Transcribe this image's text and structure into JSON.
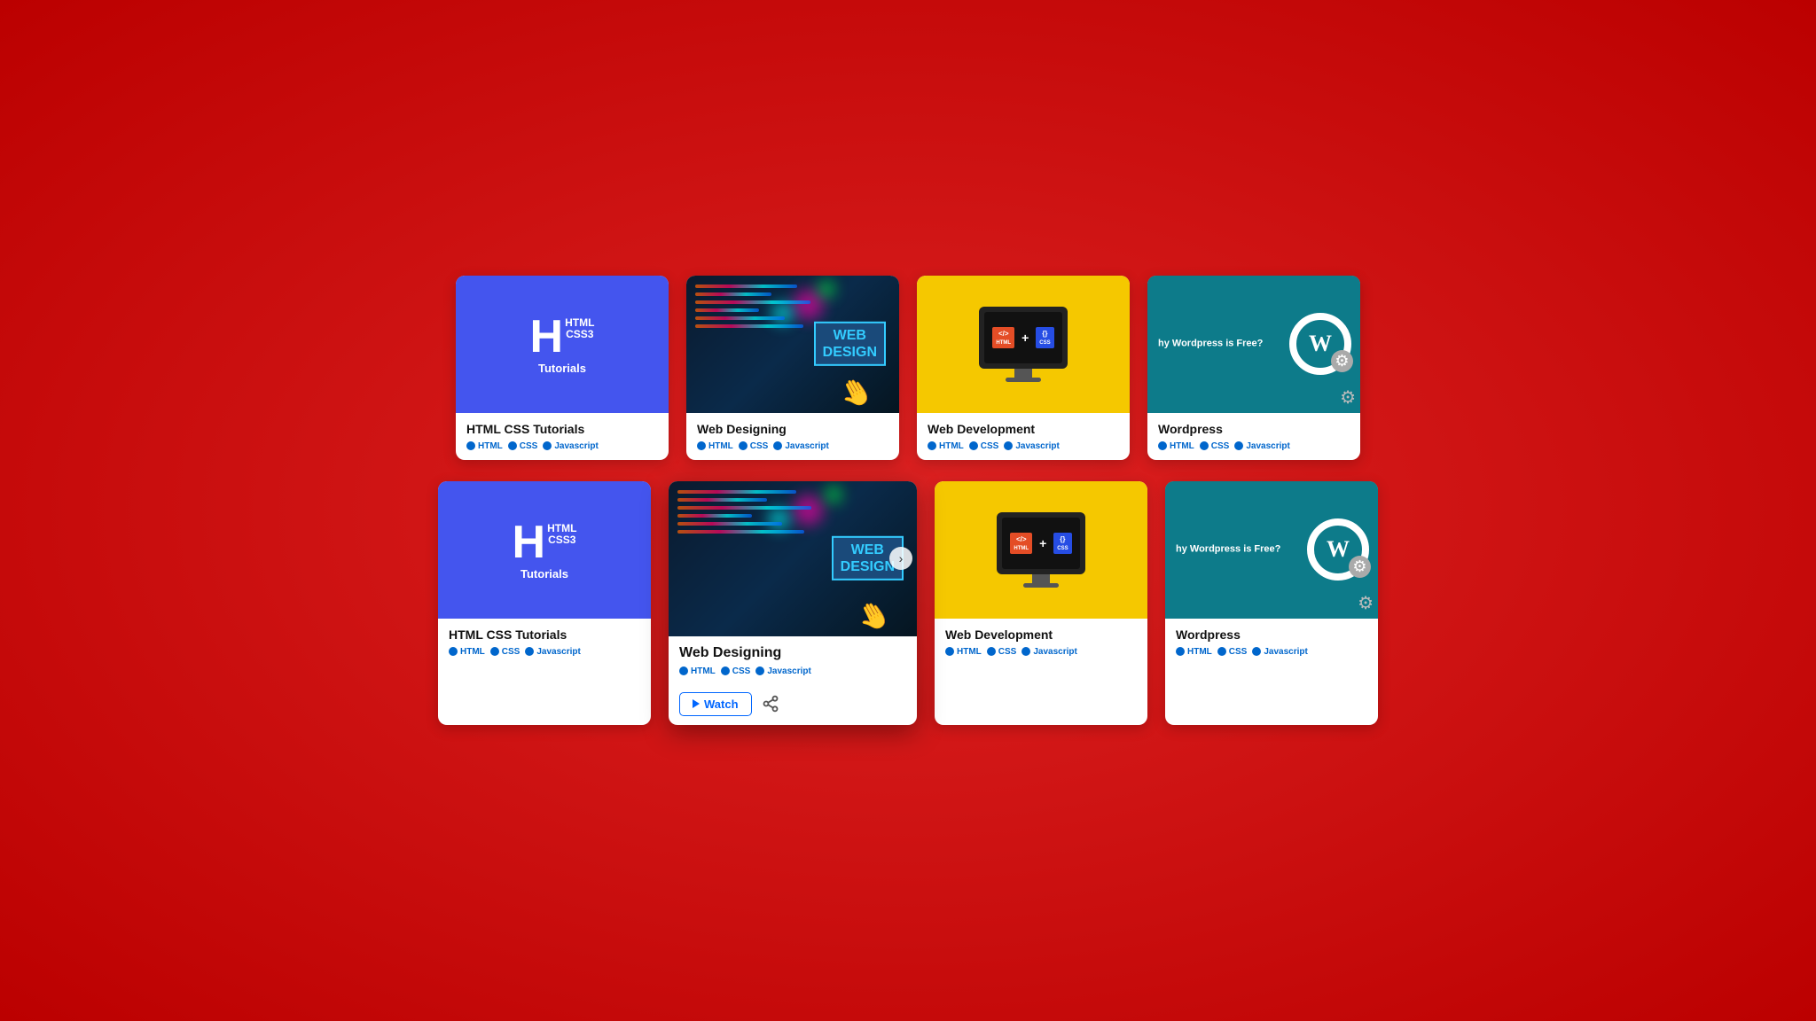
{
  "rows": [
    {
      "id": "row1",
      "cards": [
        {
          "id": "card-html-css-1",
          "type": "html-css",
          "title": "HTML CSS Tutorials",
          "tags": [
            "HTML",
            "CSS",
            "Javascript"
          ],
          "expanded": false,
          "thumb_bg": "blue"
        },
        {
          "id": "card-web-design-1",
          "type": "web-design",
          "title": "Web Designing",
          "tags": [
            "HTML",
            "CSS",
            "Javascript"
          ],
          "expanded": false,
          "thumb_bg": "teal"
        },
        {
          "id": "card-web-dev-1",
          "type": "web-dev",
          "title": "Web Development",
          "tags": [
            "HTML",
            "CSS",
            "Javascript"
          ],
          "expanded": false,
          "thumb_bg": "yellow"
        },
        {
          "id": "card-wp-1",
          "type": "wordpress",
          "title": "Wordpress",
          "tags": [
            "HTML",
            "CSS",
            "Javascript"
          ],
          "expanded": false,
          "thumb_bg": "dteal"
        }
      ]
    },
    {
      "id": "row2",
      "cards": [
        {
          "id": "card-html-css-2",
          "type": "html-css",
          "title": "HTML CSS Tutorials",
          "tags": [
            "HTML",
            "CSS",
            "Javascript"
          ],
          "expanded": false,
          "thumb_bg": "blue"
        },
        {
          "id": "card-web-design-2",
          "type": "web-design",
          "title": "Web Designing",
          "tags": [
            "HTML",
            "CSS",
            "Javascript"
          ],
          "expanded": true,
          "thumb_bg": "teal",
          "watch_label": "Watch"
        },
        {
          "id": "card-web-dev-2",
          "type": "web-dev",
          "title": "Web Development",
          "tags": [
            "HTML",
            "CSS",
            "Javascript"
          ],
          "expanded": false,
          "thumb_bg": "yellow"
        },
        {
          "id": "card-wp-2",
          "type": "wordpress",
          "title": "Wordpress",
          "tags": [
            "HTML",
            "CSS",
            "Javascript"
          ],
          "expanded": false,
          "thumb_bg": "dteal"
        }
      ]
    }
  ],
  "labels": {
    "html": "HTML",
    "css": "CSS",
    "javascript": "Javascript",
    "watch": "Watch",
    "html_css_line1": "HTML",
    "html_css_line2": "CSS3",
    "tutorials": "Tutorials",
    "web_design_label": "WEB\nDESIGN",
    "why_wordpress": "hy Wordpress is Free?",
    "html_badge": "</>",
    "css_badge": "{}"
  }
}
